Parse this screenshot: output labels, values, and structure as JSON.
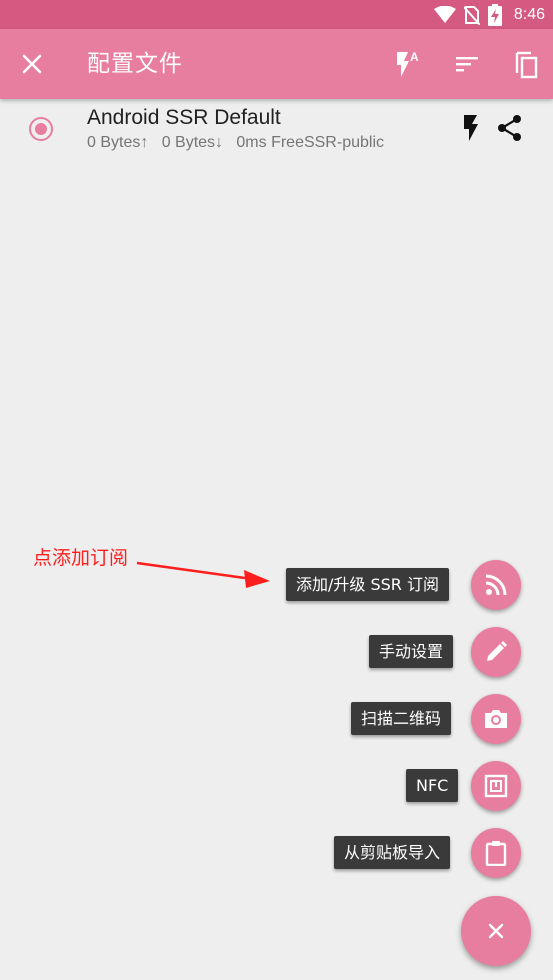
{
  "status_bar": {
    "time": "8:46",
    "icons": [
      "wifi-icon",
      "no-sim-icon",
      "battery-charging-icon"
    ]
  },
  "toolbar": {
    "title": "配置文件",
    "close_icon": "close-icon",
    "actions": [
      "flash-auto-icon",
      "sort-icon",
      "copy-icon"
    ],
    "colors": {
      "toolbar": "#e77d9f",
      "status_bar": "#d55a82"
    }
  },
  "profile": {
    "name": "Android SSR Default",
    "stats": "0 Bytes↑   0 Bytes↓   0ms FreeSSR-public",
    "selected": true,
    "actions": [
      "flash-icon",
      "share-icon"
    ]
  },
  "annotation": {
    "text": "点添加订阅",
    "color": "#ff1e1e"
  },
  "fab_menu": {
    "items": [
      {
        "label": "添加/升级 SSR 订阅",
        "icon": "rss-icon"
      },
      {
        "label": "手动设置",
        "icon": "pencil-icon"
      },
      {
        "label": "扫描二维码",
        "icon": "camera-icon"
      },
      {
        "label": "NFC",
        "icon": "nfc-icon"
      },
      {
        "label": "从剪贴板导入",
        "icon": "clipboard-icon"
      }
    ],
    "main_icon": "close-icon",
    "accent_color": "#e77d9f"
  }
}
